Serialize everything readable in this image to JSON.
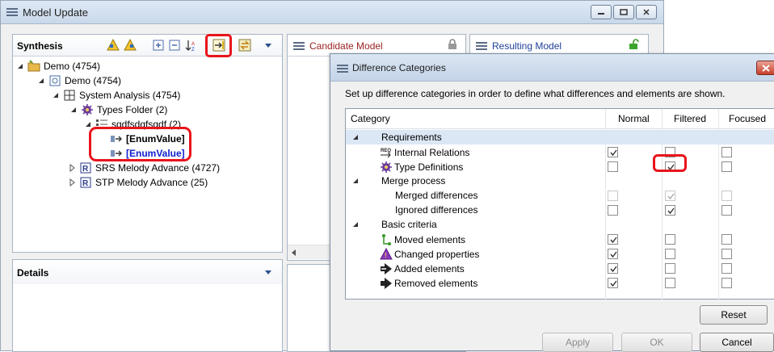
{
  "window": {
    "title": "Model Update"
  },
  "synthesis": {
    "title": "Synthesis",
    "tree": [
      {
        "label": "Demo (4754)"
      },
      {
        "label": "Demo (4754)"
      },
      {
        "label": "System Analysis (4754)"
      },
      {
        "label": "Types Folder (2)"
      },
      {
        "label": "sqdfsdqfsqdf (2)"
      },
      {
        "label": "[EnumValue]"
      },
      {
        "label": "[EnumValue]"
      },
      {
        "label": "SRS Melody Advance (4727)"
      },
      {
        "label": "STP Melody Advance (25)"
      }
    ]
  },
  "details": {
    "title": "Details"
  },
  "candidate": {
    "title": "Candidate Model"
  },
  "resulting": {
    "title": "Resulting Model"
  },
  "dialog": {
    "title": "Difference Categories",
    "description": "Set up difference categories in order to define what differences and elements are shown.",
    "columns": [
      "Category",
      "Normal",
      "Filtered",
      "Focused"
    ],
    "rows": [
      {
        "label": "Requirements",
        "group": true
      },
      {
        "label": "Internal Relations",
        "icon": "req-relation-icon",
        "normal": true,
        "filtered": false,
        "focused": false
      },
      {
        "label": "Type Definitions",
        "icon": "type-definition-icon",
        "normal": false,
        "filtered": true,
        "focused": false
      },
      {
        "label": "Merge process",
        "group": true
      },
      {
        "label": "Merged differences",
        "normal": false,
        "filtered": true,
        "focused": false,
        "disabled": true
      },
      {
        "label": "Ignored differences",
        "normal": false,
        "filtered": true,
        "focused": false
      },
      {
        "label": "Basic criteria",
        "group": true
      },
      {
        "label": "Moved elements",
        "icon": "moved-icon",
        "normal": true,
        "filtered": false,
        "focused": false
      },
      {
        "label": "Changed properties",
        "icon": "changed-icon",
        "normal": true,
        "filtered": false,
        "focused": false
      },
      {
        "label": "Added elements",
        "icon": "added-icon",
        "normal": true,
        "filtered": false,
        "focused": false
      },
      {
        "label": "Removed elements",
        "icon": "removed-icon",
        "normal": true,
        "filtered": false,
        "focused": false
      }
    ],
    "reset_label": "Reset",
    "apply_label": "Apply",
    "ok_label": "OK",
    "cancel_label": "Cancel"
  },
  "colors": {
    "highlight": "#e8141b",
    "enum_blue": "#1020d0",
    "candidate_title": "#9a1f1f",
    "resulting_title": "#1f3f9a"
  }
}
